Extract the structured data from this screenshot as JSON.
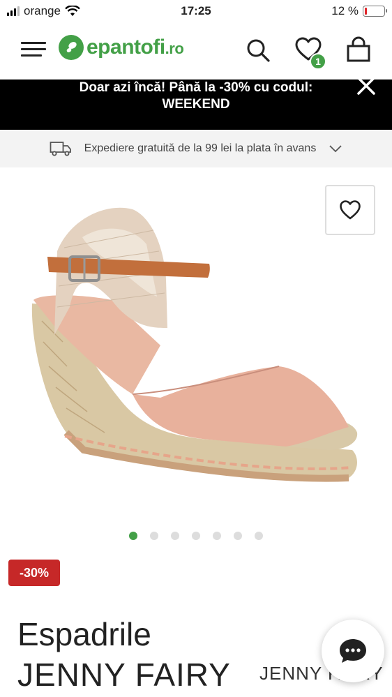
{
  "status_bar": {
    "carrier": "orange",
    "time": "17:25",
    "battery": "12 %"
  },
  "header": {
    "logo_text": "epantofi",
    "logo_suffix": ".ro",
    "favorites_count": "1"
  },
  "promo": {
    "line1": "Doar azi încă! Până la -30% cu codul:",
    "line2": "WEEKEND"
  },
  "shipping": {
    "text": "Expediere gratuită de la 99 lei la plata în avans"
  },
  "gallery": {
    "dots": 7,
    "active_index": 0
  },
  "product": {
    "discount": "-30%",
    "title_line1": "Espadrile",
    "title_line2": "JENNY FAIRY",
    "brand_logo": "JENNY FAIRY"
  },
  "colors": {
    "brand_green": "#43a047",
    "discount_red": "#c62828",
    "promo_bg": "#000000"
  }
}
